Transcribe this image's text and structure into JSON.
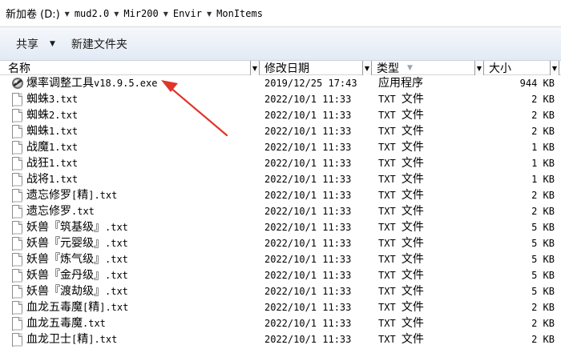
{
  "address": {
    "crumbs": [
      "新加卷 (D:)",
      "mud2.0",
      "Mir200",
      "Envir",
      "MonItems"
    ]
  },
  "toolbar": {
    "share_label": "共享",
    "new_folder_label": "新建文件夹"
  },
  "columns": {
    "name": "名称",
    "date": "修改日期",
    "type": "类型",
    "size": "大小"
  },
  "files": [
    {
      "name": "爆率调整工具v18.9.5.exe",
      "date": "2019/12/25 17:43",
      "type": "应用程序",
      "size": "944 KB",
      "icon": "exe-icon"
    },
    {
      "name": "蜘蛛3.txt",
      "date": "2022/10/1 11:33",
      "type": "TXT 文件",
      "size": "2 KB",
      "icon": "text-file-icon"
    },
    {
      "name": "蜘蛛2.txt",
      "date": "2022/10/1 11:33",
      "type": "TXT 文件",
      "size": "2 KB",
      "icon": "text-file-icon"
    },
    {
      "name": "蜘蛛1.txt",
      "date": "2022/10/1 11:33",
      "type": "TXT 文件",
      "size": "2 KB",
      "icon": "text-file-icon"
    },
    {
      "name": "战魔1.txt",
      "date": "2022/10/1 11:33",
      "type": "TXT 文件",
      "size": "1 KB",
      "icon": "text-file-icon"
    },
    {
      "name": "战狂1.txt",
      "date": "2022/10/1 11:33",
      "type": "TXT 文件",
      "size": "1 KB",
      "icon": "text-file-icon"
    },
    {
      "name": "战将1.txt",
      "date": "2022/10/1 11:33",
      "type": "TXT 文件",
      "size": "1 KB",
      "icon": "text-file-icon"
    },
    {
      "name": "遗忘修罗[精].txt",
      "date": "2022/10/1 11:33",
      "type": "TXT 文件",
      "size": "2 KB",
      "icon": "text-file-icon"
    },
    {
      "name": "遗忘修罗.txt",
      "date": "2022/10/1 11:33",
      "type": "TXT 文件",
      "size": "2 KB",
      "icon": "text-file-icon"
    },
    {
      "name": "妖兽『筑基级』.txt",
      "date": "2022/10/1 11:33",
      "type": "TXT 文件",
      "size": "5 KB",
      "icon": "text-file-icon"
    },
    {
      "name": "妖兽『元婴级』.txt",
      "date": "2022/10/1 11:33",
      "type": "TXT 文件",
      "size": "5 KB",
      "icon": "text-file-icon"
    },
    {
      "name": "妖兽『炼气级』.txt",
      "date": "2022/10/1 11:33",
      "type": "TXT 文件",
      "size": "5 KB",
      "icon": "text-file-icon"
    },
    {
      "name": "妖兽『金丹级』.txt",
      "date": "2022/10/1 11:33",
      "type": "TXT 文件",
      "size": "5 KB",
      "icon": "text-file-icon"
    },
    {
      "name": "妖兽『渡劫级』.txt",
      "date": "2022/10/1 11:33",
      "type": "TXT 文件",
      "size": "5 KB",
      "icon": "text-file-icon"
    },
    {
      "name": "血龙五毒魔[精].txt",
      "date": "2022/10/1 11:33",
      "type": "TXT 文件",
      "size": "2 KB",
      "icon": "text-file-icon"
    },
    {
      "name": "血龙五毒魔.txt",
      "date": "2022/10/1 11:33",
      "type": "TXT 文件",
      "size": "2 KB",
      "icon": "text-file-icon"
    },
    {
      "name": "血龙卫士[精].txt",
      "date": "2022/10/1 11:33",
      "type": "TXT 文件",
      "size": "2 KB",
      "icon": "text-file-icon"
    }
  ],
  "colors": {
    "annotation_arrow": "#e0352b",
    "toolbar_top": "#f5f8fc",
    "toolbar_bottom": "#e3eaf4"
  }
}
